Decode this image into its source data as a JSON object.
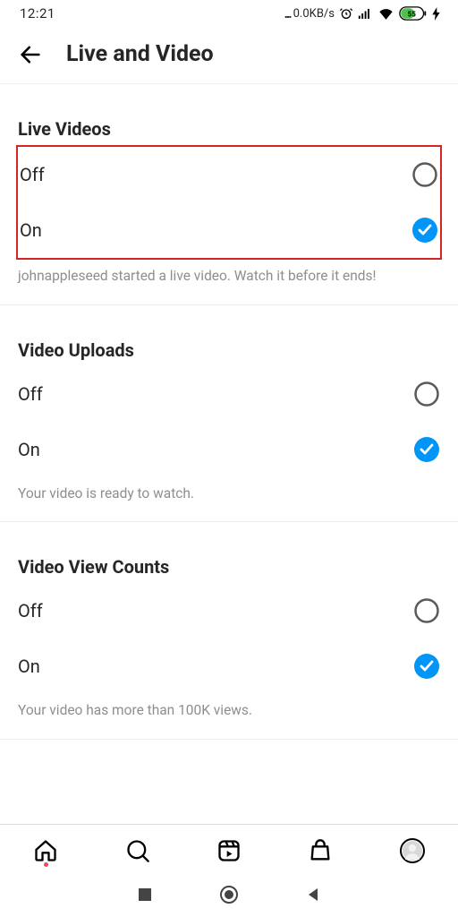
{
  "status": {
    "time": "12:21",
    "netspeed": "0.0KB/s",
    "battery_pct": "55"
  },
  "header": {
    "title": "Live and Video"
  },
  "sections": {
    "live_videos": {
      "title": "Live Videos",
      "off_label": "Off",
      "on_label": "On",
      "helper": "johnappleseed started a live video. Watch it before it ends!"
    },
    "video_uploads": {
      "title": "Video Uploads",
      "off_label": "Off",
      "on_label": "On",
      "helper": "Your video is ready to watch."
    },
    "video_view_counts": {
      "title": "Video View Counts",
      "off_label": "Off",
      "on_label": "On",
      "helper": "Your video has more than 100K views."
    }
  }
}
